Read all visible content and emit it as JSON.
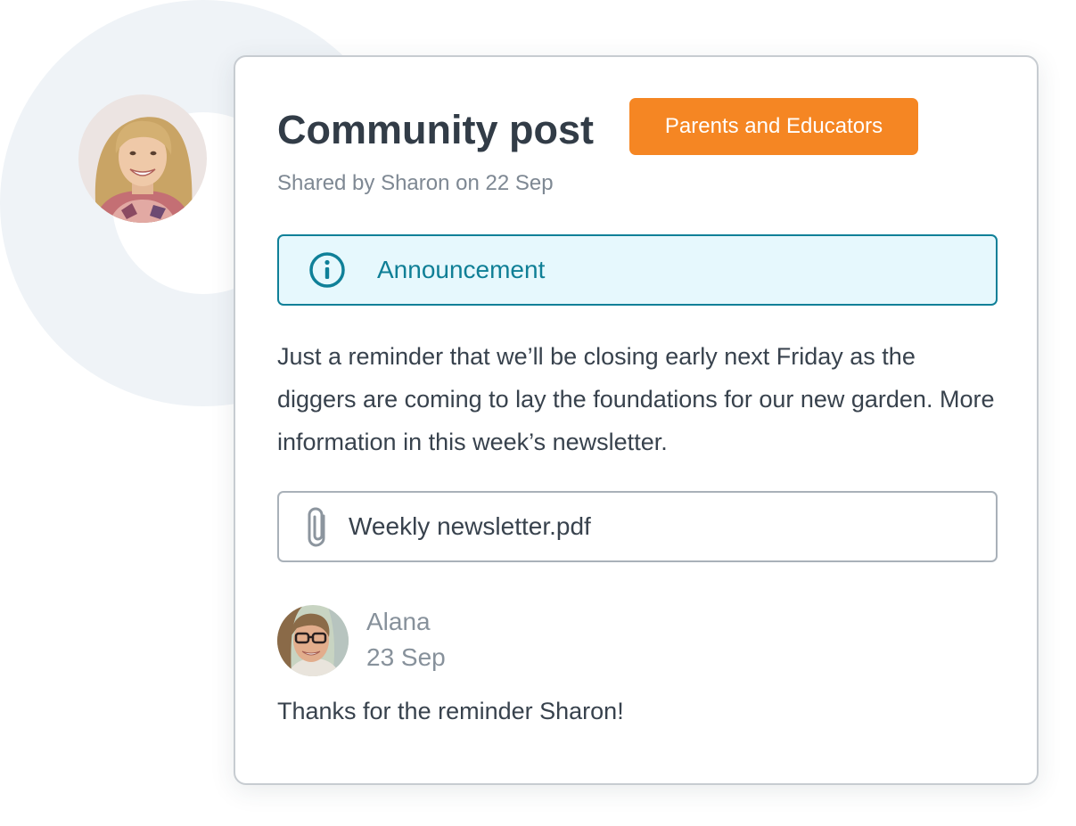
{
  "post": {
    "title": "Community post",
    "audience_badge": "Parents and Educators",
    "shared_line": "Shared by Sharon on 22 Sep",
    "category_label": "Announcement",
    "category_icon": "info-icon",
    "body": "Just a reminder that we’ll be closing early next Friday as the diggers are coming to lay the foundations for our new garden. More information in this week’s newsletter.",
    "attachment": {
      "icon": "paperclip-icon",
      "file_name": "Weekly newsletter.pdf"
    }
  },
  "comment": {
    "author": "Alana",
    "date": "23 Sep",
    "text": "Thanks for the reminder Sharon!"
  },
  "colors": {
    "badge": "#f58623",
    "announcement_accent": "#0f8098",
    "announcement_bg": "#e6f8fd",
    "title": "#323c47",
    "muted": "#7e8893"
  }
}
